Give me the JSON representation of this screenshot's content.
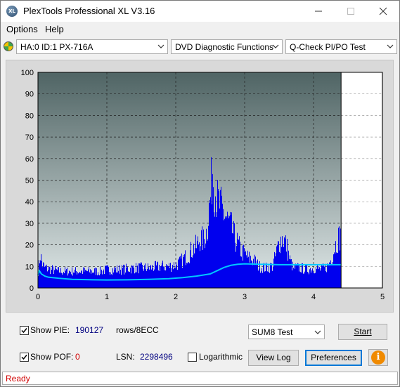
{
  "window": {
    "title": "PlexTools Professional XL V3.16",
    "icon_text": "XL"
  },
  "menu": {
    "options": "Options",
    "help": "Help"
  },
  "toolbar": {
    "drive": "HA:0 ID:1  PX-716A",
    "function": "DVD Diagnostic Functions",
    "test": "Q-Check PI/PO Test"
  },
  "controls": {
    "show_pie_label": "Show PIE:",
    "pie_value": "190127",
    "pie_unit": "rows/8ECC",
    "show_pof_label": "Show POF:",
    "pof_value": "0",
    "lsn_label": "LSN:",
    "lsn_value": "2298496",
    "log_label": "Logarithmic",
    "sum_select": "SUM8 Test",
    "start_label": "Start",
    "viewlog_label": "View Log",
    "prefs_label": "Preferences",
    "info_icon": "i"
  },
  "status": {
    "text": "Ready"
  },
  "colors": {
    "plot_top": "#4f6464",
    "plot_bottom": "#e0e8e8",
    "bars": "#0000ee",
    "avg_line": "#00c8ff",
    "status_text": "#d00000",
    "pie_value": "#000080",
    "pof_value": "#d00000"
  },
  "chart_data": {
    "type": "bar",
    "title": "",
    "xlabel": "",
    "ylabel": "",
    "xlim": [
      0,
      5
    ],
    "ylim": [
      0,
      100
    ],
    "x_ticks": [
      "0",
      "1",
      "2",
      "3",
      "4",
      "5"
    ],
    "y_ticks": [
      "0",
      "10",
      "20",
      "30",
      "40",
      "50",
      "60",
      "70",
      "80",
      "90",
      "100"
    ],
    "grid": true,
    "end_marker_x": 4.4,
    "series": [
      {
        "values_type": "PIE per sample (peak envelope)",
        "x": [
          0.0,
          0.03,
          0.06,
          0.1,
          0.2,
          0.3,
          0.5,
          0.7,
          0.9,
          1.0,
          1.2,
          1.4,
          1.6,
          1.8,
          1.9,
          2.0,
          2.05,
          2.1,
          2.15,
          2.2,
          2.25,
          2.3,
          2.35,
          2.4,
          2.45,
          2.5,
          2.53,
          2.56,
          2.6,
          2.65,
          2.7,
          2.75,
          2.8,
          2.85,
          2.9,
          2.95,
          3.0,
          3.05,
          3.1,
          3.15,
          3.2,
          3.3,
          3.4,
          3.45,
          3.5,
          3.55,
          3.6,
          3.65,
          3.7,
          3.8,
          3.9,
          4.0,
          4.1,
          4.2,
          4.25,
          4.3,
          4.35,
          4.4
        ],
        "values": [
          10,
          20,
          14,
          12,
          11,
          10,
          10,
          10,
          10,
          11,
          11,
          12,
          12,
          13,
          13,
          14,
          15,
          17,
          19,
          21,
          24,
          25,
          30,
          28,
          35,
          55,
          72,
          60,
          52,
          48,
          44,
          40,
          36,
          30,
          26,
          22,
          20,
          18,
          17,
          16,
          13,
          12,
          13,
          20,
          28,
          30,
          26,
          17,
          12,
          12,
          11,
          12,
          11,
          13,
          17,
          24,
          30,
          31
        ]
      },
      {
        "values_type": "average line",
        "x": [
          0.0,
          0.02,
          0.05,
          0.1,
          0.15,
          0.3,
          0.5,
          0.8,
          1.0,
          1.3,
          1.6,
          1.9,
          2.1,
          2.3,
          2.5,
          2.6,
          2.7,
          2.8,
          2.9,
          3.0,
          3.2,
          3.5,
          3.8,
          4.0,
          4.2,
          4.4
        ],
        "values": [
          6,
          8,
          6.5,
          5.5,
          5,
          4.5,
          4,
          3.8,
          3.7,
          3.8,
          4,
          4.3,
          4.8,
          5.5,
          6.5,
          8,
          9.5,
          10.5,
          11,
          11.2,
          11,
          10.8,
          10.8,
          10.8,
          10.8,
          10.8
        ]
      }
    ]
  }
}
